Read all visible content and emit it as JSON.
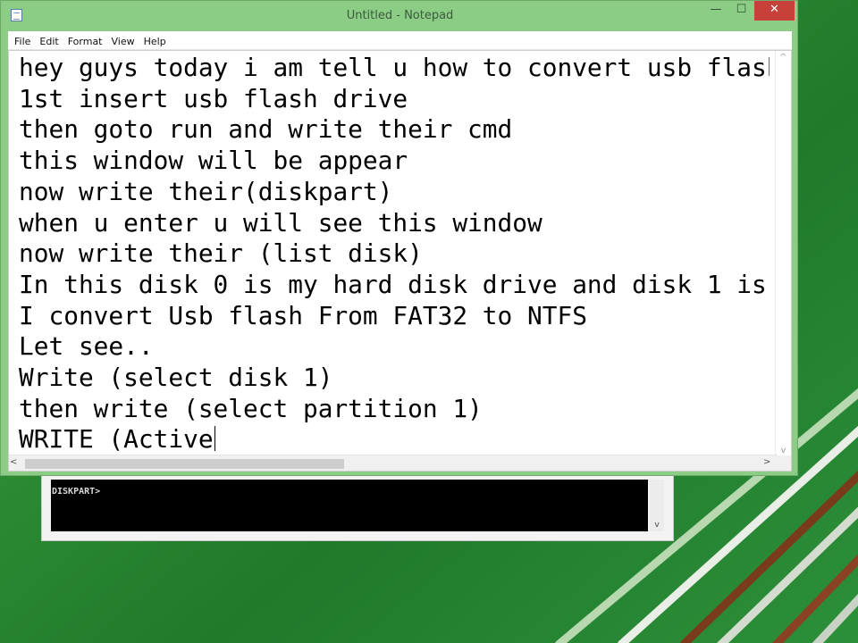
{
  "window": {
    "title": "Untitled - Notepad",
    "minimize_glyph": "—",
    "maximize_glyph": "☐",
    "close_glyph": "✕"
  },
  "menu": {
    "items": [
      "File",
      "Edit",
      "Format",
      "View",
      "Help"
    ]
  },
  "editor": {
    "lines": [
      "hey guys today i am tell u how to convert usb flash",
      "1st insert usb flash drive",
      "then goto run and write their cmd",
      "this window will be appear",
      "now write their(diskpart)",
      "when u enter u will see this window",
      "now write their (list disk)",
      "In this disk 0 is my hard disk drive and disk 1 is",
      "I convert Usb flash From FAT32 to NTFS",
      "Let see..",
      "Write (select disk 1)",
      "then write (select partition 1)",
      "WRITE (Active"
    ]
  },
  "console": {
    "prompt": "DISKPART>"
  },
  "colors": {
    "title_bar": "#8ccd86",
    "close_button": "#c7413a",
    "desktop": "#2c8a33"
  }
}
